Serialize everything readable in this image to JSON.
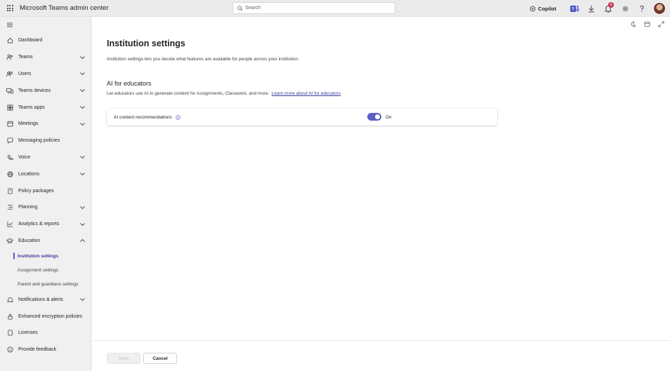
{
  "app": {
    "title": "Microsoft Teams admin center",
    "search_placeholder": "Search",
    "copilot_label": "Copilot",
    "notification_count": "1",
    "icons": [
      "waffle-icon",
      "search-icon",
      "copilot-icon",
      "teams-icon",
      "download-icon",
      "bell-icon",
      "gear-icon",
      "help-icon",
      "avatar"
    ]
  },
  "sidebar": {
    "items": [
      {
        "label": "Dashboard",
        "icon": "home-icon",
        "expandable": false
      },
      {
        "label": "Teams",
        "icon": "teams-icon",
        "expandable": true
      },
      {
        "label": "Users",
        "icon": "users-icon",
        "expandable": true
      },
      {
        "label": "Teams devices",
        "icon": "devices-icon",
        "expandable": true
      },
      {
        "label": "Teams apps",
        "icon": "apps-icon",
        "expandable": true
      },
      {
        "label": "Meetings",
        "icon": "calendar-icon",
        "expandable": true
      },
      {
        "label": "Messaging policies",
        "icon": "chat-icon",
        "expandable": false
      },
      {
        "label": "Voice",
        "icon": "voice-icon",
        "expandable": true
      },
      {
        "label": "Locations",
        "icon": "globe-icon",
        "expandable": true
      },
      {
        "label": "Policy packages",
        "icon": "package-icon",
        "expandable": false
      },
      {
        "label": "Planning",
        "icon": "list-icon",
        "expandable": true
      },
      {
        "label": "Analytics & reports",
        "icon": "chart-icon",
        "expandable": true
      },
      {
        "label": "Education",
        "icon": "education-icon",
        "expandable": true,
        "expanded": true
      }
    ],
    "education_sub": [
      {
        "label": "Institution settings",
        "active": true
      },
      {
        "label": "Assignment settings",
        "active": false
      },
      {
        "label": "Parent and guardians settings",
        "active": false
      }
    ],
    "items_after": [
      {
        "label": "Notifications & alerts",
        "icon": "bell-icon",
        "expandable": true
      },
      {
        "label": "Enhanced encryption policies",
        "icon": "lock-icon",
        "expandable": false
      },
      {
        "label": "Licenses",
        "icon": "license-icon",
        "expandable": false
      },
      {
        "label": "Provide feedback",
        "icon": "feedback-icon",
        "expandable": false
      }
    ]
  },
  "main": {
    "title": "Institution settings",
    "description": "Institution settings lets you decide what features are available for people across your institution.",
    "section": {
      "title": "AI for educators",
      "description": "Let educators use AI to generate content for Assignments, Classwork, and more.",
      "link_text": "Learn more about AI for educators"
    },
    "setting": {
      "label": "AI content recommendations",
      "toggle_on": true,
      "toggle_label": "On"
    }
  },
  "footer": {
    "save_label": "Save",
    "cancel_label": "Cancel"
  },
  "colors": {
    "accent": "#5b5fc7",
    "link": "#3b3a9c",
    "sidebar_bg": "#f0f0f0",
    "topbar_bg": "#ebebeb"
  }
}
